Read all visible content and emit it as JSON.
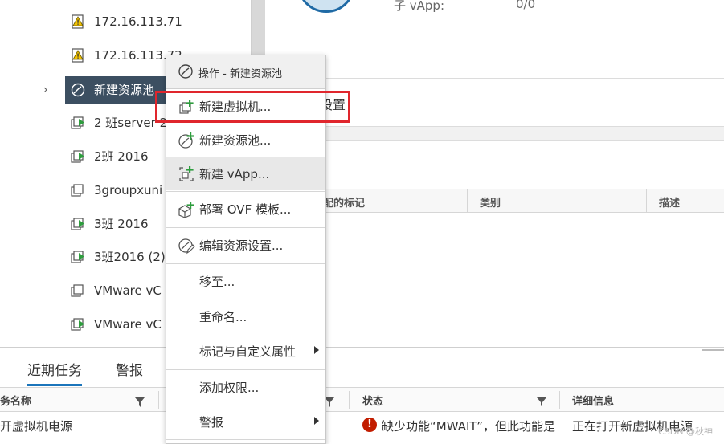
{
  "tree": {
    "items": [
      {
        "label": "172.16.113.71",
        "icon": "host-warning-icon"
      },
      {
        "label": "172.16.113.72",
        "icon": "host-warning-icon"
      },
      {
        "label": "新建资源池",
        "icon": "resource-pool-icon",
        "selected": true
      },
      {
        "label": "2 班server 2",
        "icon": "vm-powered-on-icon"
      },
      {
        "label": "2班 2016",
        "icon": "vm-powered-on-icon"
      },
      {
        "label": "3groupxuni",
        "icon": "vm-powered-off-icon"
      },
      {
        "label": "3班 2016",
        "icon": "vm-powered-on-icon"
      },
      {
        "label": "3班2016 (2)",
        "icon": "vm-powered-on-icon"
      },
      {
        "label": "VMware vC",
        "icon": "vm-powered-off-icon"
      },
      {
        "label": "VMware vC",
        "icon": "vm-powered-on-icon"
      }
    ]
  },
  "summary": {
    "vapp_label": "子 vApp:",
    "vapp_value": "0/0",
    "settings_text": "设置"
  },
  "tags_table": {
    "columns": [
      "配的标记",
      "类别",
      "描述"
    ]
  },
  "context_menu": {
    "header": "操作 - 新建资源池",
    "items": [
      {
        "label": "新建虚拟机...",
        "icon": "new-vm-icon"
      },
      {
        "label": "新建资源池...",
        "icon": "new-resource-pool-icon"
      },
      {
        "label": "新建 vApp...",
        "icon": "new-vapp-icon"
      },
      {
        "label": "部署 OVF 模板...",
        "icon": "deploy-ovf-icon"
      },
      {
        "label": "编辑资源设置...",
        "icon": "edit-resource-settings-icon"
      },
      {
        "label": "移至..."
      },
      {
        "label": "重命名..."
      },
      {
        "label": "标记与自定义属性",
        "submenu": true
      },
      {
        "label": "添加权限..."
      },
      {
        "label": "警报",
        "submenu": true
      }
    ]
  },
  "bottom_panel": {
    "tabs": [
      "近期任务",
      "警报"
    ],
    "columns": {
      "task_name": "务名称",
      "status": "状态",
      "details": "详细信息"
    },
    "rows": [
      {
        "task_name": "开虚拟机电源",
        "status": "缺少功能“MWAIT”，但此功能是",
        "details": "正在打开新虚拟机电源"
      }
    ]
  },
  "watermark": "CSDN @秋神",
  "colors": {
    "selected_bg": "#3c4f61",
    "accent_blue": "#1b75bb",
    "highlight_red": "#e0262d",
    "error_red": "#c21d00",
    "vm_green": "#2e9d3e",
    "warning_yellow": "#f2c200"
  }
}
